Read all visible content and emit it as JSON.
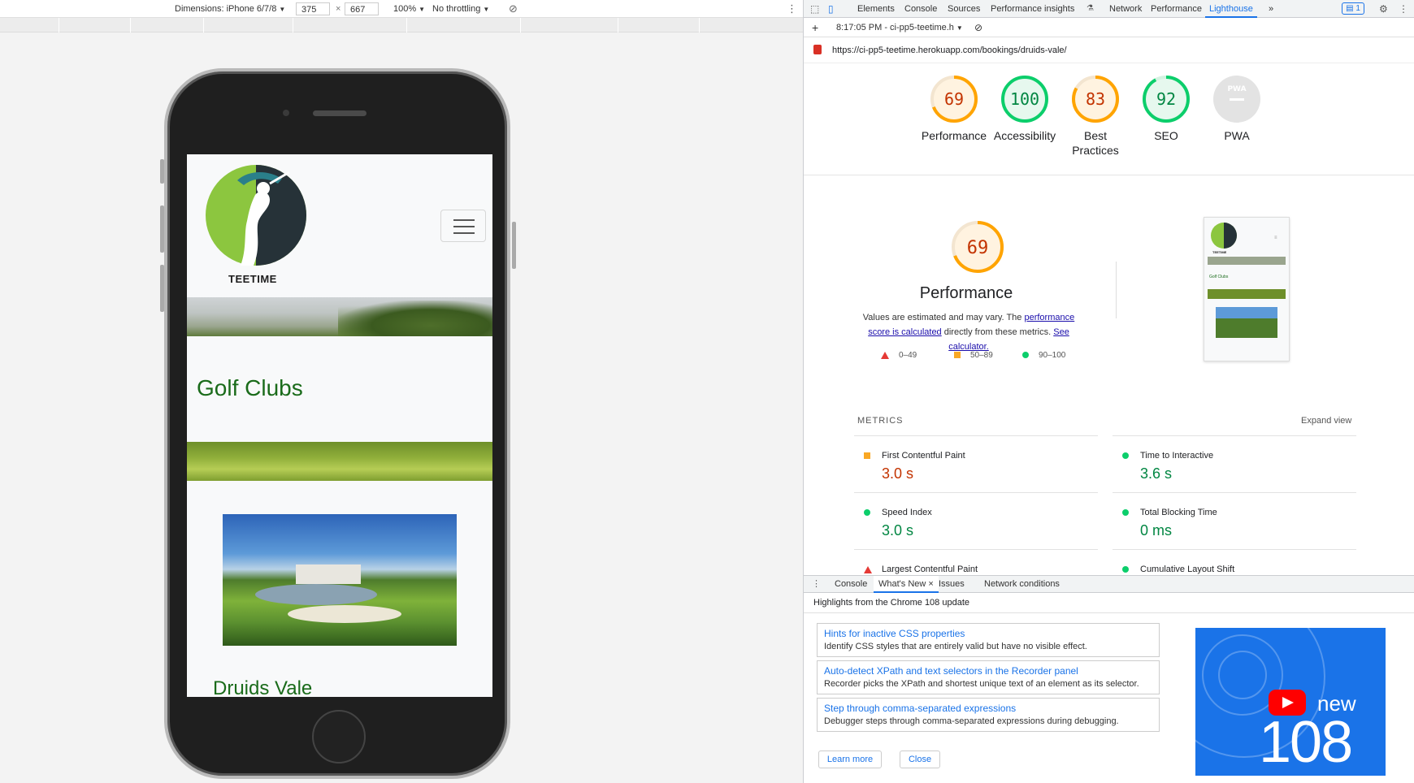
{
  "device_toolbar": {
    "dimensions_label": "Dimensions: iPhone 6/7/8",
    "width_value": "375",
    "times": "×",
    "height_value": "667",
    "zoom": "100%",
    "throttling": "No throttling"
  },
  "site": {
    "logo_text": "TEETIME",
    "card1_title": "Golf Clubs",
    "card2_title": "Druids Vale"
  },
  "devtools": {
    "tabs": [
      "Elements",
      "Console",
      "Sources",
      "Performance insights",
      "Network",
      "Performance",
      "Lighthouse"
    ],
    "active_tab": "Lighthouse",
    "more_tabs": "»",
    "messages_count": "1",
    "report_time": "8:17:05 PM - ci-pp5-teetime.h",
    "url": "https://ci-pp5-teetime.herokuapp.com/bookings/druids-vale/"
  },
  "gauges": [
    {
      "score": 69,
      "label": "Performance",
      "color": "#ffa400",
      "text_color": "#c33300",
      "bg": "#fff3e0"
    },
    {
      "score": 100,
      "label": "Accessibility",
      "color": "#0cce6b",
      "text_color": "#018642",
      "bg": "#e6f8ee"
    },
    {
      "score": 83,
      "label": "Best Practices",
      "color": "#ffa400",
      "text_color": "#c33300",
      "bg": "#fff3e0"
    },
    {
      "score": 92,
      "label": "SEO",
      "color": "#0cce6b",
      "text_color": "#018642",
      "bg": "#e6f8ee"
    },
    {
      "score": null,
      "label": "PWA",
      "badge": "PWA"
    }
  ],
  "performance": {
    "score": 69,
    "title": "Performance",
    "desc_pre": "Values are estimated and may vary. The ",
    "desc_link1": "performance score is calculated",
    "desc_mid": " directly from these metrics. ",
    "desc_link2": "See calculator.",
    "legend": [
      "0–49",
      "50–89",
      "90–100"
    ]
  },
  "metrics": {
    "heading": "METRICS",
    "expand": "Expand view",
    "items": [
      {
        "label": "First Contentful Paint",
        "value": "3.0 s",
        "rating": "average"
      },
      {
        "label": "Time to Interactive",
        "value": "3.6 s",
        "rating": "pass"
      },
      {
        "label": "Speed Index",
        "value": "3.0 s",
        "rating": "pass"
      },
      {
        "label": "Total Blocking Time",
        "value": "0 ms",
        "rating": "pass"
      },
      {
        "label": "Largest Contentful Paint",
        "value": "",
        "rating": "fail"
      },
      {
        "label": "Cumulative Layout Shift",
        "value": "",
        "rating": "pass"
      }
    ]
  },
  "drawer": {
    "tabs": [
      "Console",
      "What's New",
      "Issues",
      "Network conditions"
    ],
    "active_tab": "What's New",
    "highlights": "Highlights from the Chrome 108 update",
    "features": [
      {
        "title": "Hints for inactive CSS properties",
        "desc": "Identify CSS styles that are entirely valid but have no visible effect."
      },
      {
        "title": "Auto-detect XPath and text selectors in the Recorder panel",
        "desc": "Recorder picks the XPath and shortest unique text of an element as its selector."
      },
      {
        "title": "Step through comma-separated expressions",
        "desc": "Debugger steps through comma-separated expressions during debugging."
      }
    ],
    "learn_more": "Learn more",
    "close": "Close",
    "promo_new": "new",
    "promo_version": "108"
  }
}
